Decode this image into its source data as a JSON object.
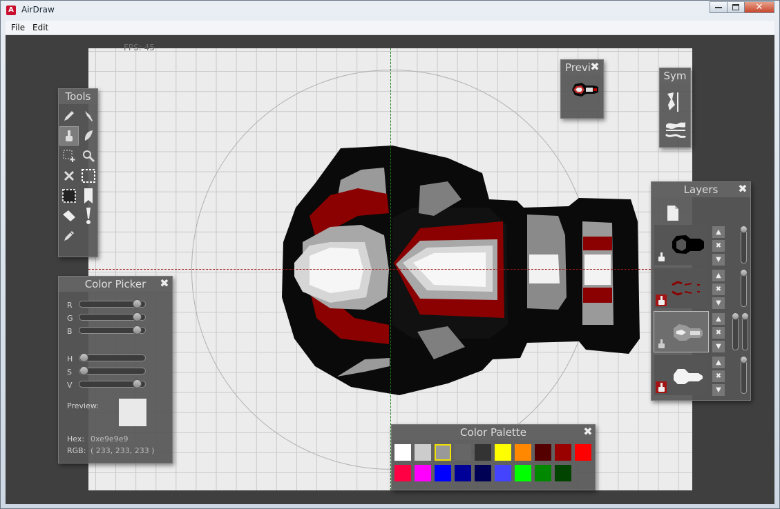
{
  "window": {
    "title": "AirDraw",
    "app_icon_glyph": "A",
    "min_icon": "minimize-icon",
    "max_icon": "maximize-icon",
    "close_glyph": "✕"
  },
  "menu": {
    "file": "File",
    "edit": "Edit"
  },
  "canvas": {
    "fps_text": "FPS: 45",
    "axis_colors": {
      "vertical": "#1e7a1e",
      "horizontal": "#a01818"
    }
  },
  "tools": {
    "title": "Tools",
    "items": [
      "pencil-icon",
      "pen-icon",
      "brush-icon",
      "feather-icon",
      "selection-add-icon",
      "zoom-icon",
      "clear-icon",
      "select-rect-icon",
      "select-subtract-icon",
      "bookmark-icon",
      "eraser-icon",
      "exclamation-icon",
      "eyedropper-icon"
    ],
    "selected": "brush-icon"
  },
  "color_picker": {
    "title": "Color Picker",
    "labels": {
      "r": "R",
      "g": "G",
      "b": "B",
      "h": "H",
      "s": "S",
      "v": "V"
    },
    "values": {
      "r": 233,
      "g": 233,
      "b": 233,
      "h": 0,
      "s": 0,
      "v": 233
    },
    "preview_label": "Preview:",
    "preview_color": "#e9e9e9",
    "hex_label": "Hex:",
    "hex_value": "0xe9e9e9",
    "rgb_label": "RGB:",
    "rgb_value": "( 233, 233, 233 )"
  },
  "preview_panel": {
    "title": "Previ"
  },
  "sym": {
    "title": "Sym",
    "items": [
      "vertical-symmetry-icon",
      "horizontal-symmetry-icon"
    ]
  },
  "layers": {
    "title": "Layers",
    "new_layer_icon": "new-layer-icon",
    "items": [
      {
        "name": "outline-layer",
        "locked": false,
        "selected": false
      },
      {
        "name": "red-layer",
        "locked": true,
        "selected": false
      },
      {
        "name": "gray-layer",
        "locked": false,
        "selected": true
      },
      {
        "name": "white-layer",
        "locked": true,
        "selected": false
      }
    ]
  },
  "palette": {
    "title": "Color Palette",
    "selected_index": 2,
    "row1": [
      "#ffffff",
      "#cccccc",
      "#999999",
      "#666666",
      "#333333",
      "#ffff00",
      "#ff8800",
      "#550000",
      "#990000",
      "#ff0000"
    ],
    "row2": [
      "#ff0044",
      "#ff00ff",
      "#0000ff",
      "#000099",
      "#000055",
      "#4444ff",
      "#00ff00",
      "#008800",
      "#004400"
    ]
  }
}
